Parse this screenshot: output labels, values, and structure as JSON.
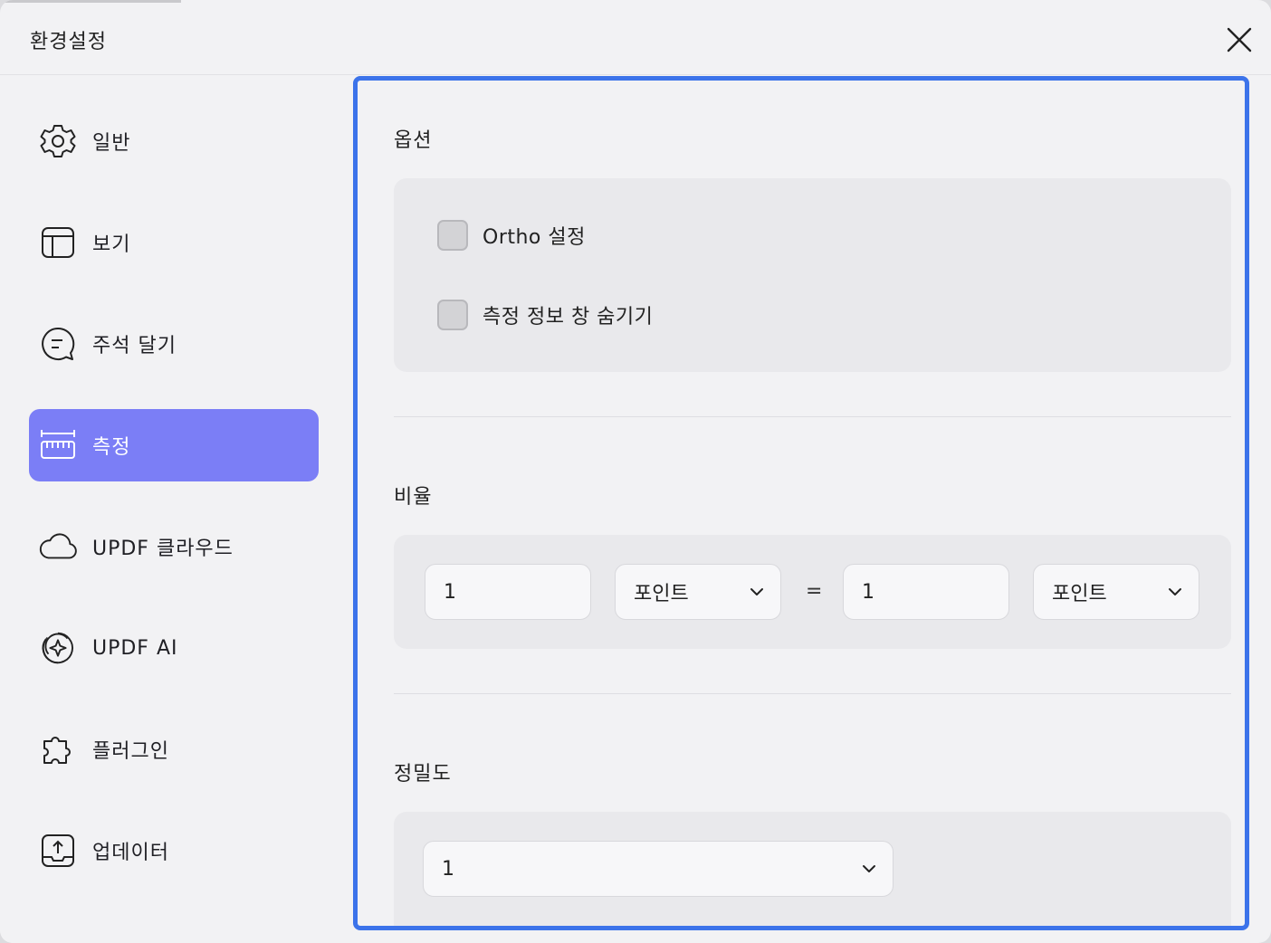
{
  "window": {
    "title": "환경설정"
  },
  "sidebar": {
    "items": [
      {
        "label": "일반",
        "icon": "gear-icon"
      },
      {
        "label": "보기",
        "icon": "layout-icon"
      },
      {
        "label": "주석 달기",
        "icon": "comment-icon"
      },
      {
        "label": "측정",
        "icon": "ruler-icon",
        "active": true
      },
      {
        "label": "UPDF 클라우드",
        "icon": "cloud-icon"
      },
      {
        "label": "UPDF AI",
        "icon": "ai-sparkle-icon"
      },
      {
        "label": "플러그인",
        "icon": "puzzle-icon"
      },
      {
        "label": "업데이터",
        "icon": "update-icon"
      }
    ]
  },
  "main": {
    "options": {
      "title": "옵션",
      "ortho_label": "Ortho 설정",
      "hide_info_label": "측정 정보 창 숨기기"
    },
    "ratio": {
      "title": "비율",
      "left_value": "1",
      "left_unit": "포인트",
      "equals": "=",
      "right_value": "1",
      "right_unit": "포인트"
    },
    "precision": {
      "title": "정밀도",
      "value": "1"
    }
  },
  "colors": {
    "accent_active": "#7b7ef6",
    "focus_border": "#3c73ea",
    "background": "#f2f2f4",
    "panel": "#e9e9ec"
  }
}
